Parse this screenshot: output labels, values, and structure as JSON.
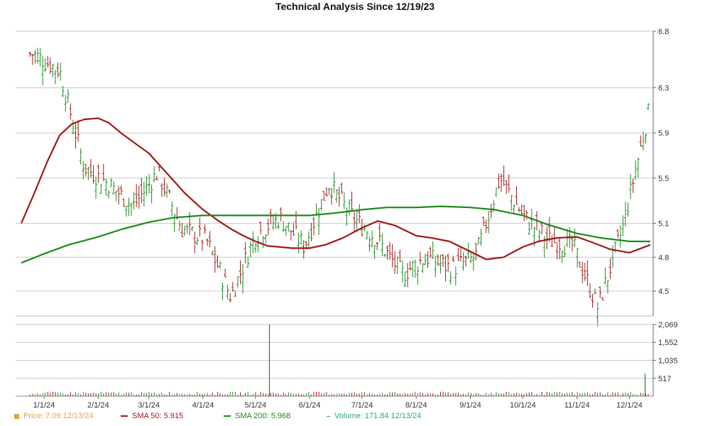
{
  "chart_data": [
    {
      "type": "candlestick-line",
      "title": "Technical Analysis Since 12/19/23",
      "ylim": [
        4.28,
        6.8
      ],
      "yticks": [
        "6.8",
        "6.3",
        "5.9",
        "5.5",
        "5.1",
        "4.8",
        "4.5"
      ],
      "ytick_values": [
        6.8,
        6.3,
        5.9,
        5.5,
        5.1,
        4.8,
        4.5
      ],
      "xticks": [
        "1/1/24",
        "2/1/24",
        "3/1/24",
        "4/1/24",
        "5/1/24",
        "6/1/24",
        "7/1/24",
        "8/1/24",
        "9/1/24",
        "10/1/24",
        "11/1/24",
        "12/1/24"
      ],
      "grid": true,
      "series": [
        {
          "name": "Price",
          "kind": "ohlc-bars",
          "color_up": "#1a8a1a",
          "color_down": "#a01818",
          "dates": [
            "12/26/23",
            "1/10/24",
            "1/24/24",
            "2/7/24",
            "2/21/24",
            "3/6/24",
            "3/20/24",
            "4/3/24",
            "4/17/24",
            "5/1/24",
            "5/15/24",
            "5/29/24",
            "6/12/24",
            "6/26/24",
            "7/10/24",
            "7/24/24",
            "8/7/24",
            "8/21/24",
            "9/4/24",
            "9/18/24",
            "10/2/24",
            "10/16/24",
            "10/30/24",
            "11/13/24",
            "11/27/24",
            "12/13/24"
          ],
          "close": [
            6.6,
            6.45,
            5.6,
            5.45,
            5.25,
            5.55,
            5.05,
            4.95,
            4.45,
            5.0,
            5.15,
            4.9,
            5.45,
            5.15,
            4.95,
            4.65,
            4.8,
            4.7,
            4.8,
            5.5,
            5.15,
            4.95,
            4.9,
            4.35,
            5.05,
            6.15
          ]
        },
        {
          "name": "SMA 50",
          "kind": "line",
          "color": "#a01818",
          "dates": [
            "12/19/23",
            "12/26/23",
            "1/3/24",
            "1/10/24",
            "1/17/24",
            "1/24/24",
            "2/1/24",
            "2/7/24",
            "2/14/24",
            "2/21/24",
            "3/1/24",
            "3/8/24",
            "3/15/24",
            "3/22/24",
            "4/1/24",
            "4/10/24",
            "4/17/24",
            "4/24/24",
            "5/1/24",
            "5/8/24",
            "5/15/24",
            "5/22/24",
            "6/1/24",
            "6/10/24",
            "6/20/24",
            "7/1/24",
            "7/10/24",
            "7/20/24",
            "8/1/24",
            "8/10/24",
            "8/20/24",
            "9/1/24",
            "9/10/24",
            "9/20/24",
            "10/1/24",
            "10/10/24",
            "10/20/24",
            "11/1/24",
            "11/10/24",
            "11/20/24",
            "12/1/24",
            "12/13/24"
          ],
          "values": [
            5.1,
            5.35,
            5.65,
            5.88,
            5.98,
            6.02,
            6.03,
            5.99,
            5.9,
            5.82,
            5.72,
            5.6,
            5.48,
            5.36,
            5.22,
            5.12,
            5.05,
            4.99,
            4.94,
            4.9,
            4.89,
            4.88,
            4.88,
            4.91,
            4.97,
            5.06,
            5.12,
            5.08,
            4.99,
            4.97,
            4.94,
            4.85,
            4.78,
            4.8,
            4.89,
            4.94,
            4.97,
            4.98,
            4.93,
            4.87,
            4.84,
            4.91
          ]
        },
        {
          "name": "SMA 200",
          "kind": "line",
          "color": "#1a8a1a",
          "dates": [
            "12/19/23",
            "1/1/24",
            "1/15/24",
            "2/1/24",
            "2/15/24",
            "3/1/24",
            "3/15/24",
            "4/1/24",
            "4/15/24",
            "5/1/24",
            "5/15/24",
            "6/1/24",
            "6/15/24",
            "7/1/24",
            "7/15/24",
            "8/1/24",
            "8/15/24",
            "9/1/24",
            "9/15/24",
            "10/1/24",
            "10/15/24",
            "11/1/24",
            "11/15/24",
            "12/1/24",
            "12/13/24"
          ],
          "values": [
            4.75,
            4.83,
            4.91,
            4.98,
            5.05,
            5.11,
            5.15,
            5.17,
            5.17,
            5.17,
            5.17,
            5.17,
            5.19,
            5.22,
            5.24,
            5.24,
            5.25,
            5.24,
            5.22,
            5.17,
            5.09,
            5.01,
            4.97,
            4.94,
            4.94
          ]
        }
      ]
    },
    {
      "type": "bar",
      "title": "",
      "ylim": [
        0,
        2069
      ],
      "yticks": [
        "2,069",
        "1,552",
        "1,035",
        "517"
      ],
      "ytick_values": [
        2069,
        1552,
        1035,
        517
      ],
      "series": [
        {
          "name": "Volume",
          "color": "#1a8a1a",
          "dates": [
            "12/26/23",
            "1/10/24",
            "1/24/24",
            "2/7/24",
            "2/21/24",
            "3/6/24",
            "3/20/24",
            "4/3/24",
            "4/17/24",
            "5/1/24",
            "5/9/24",
            "5/15/24",
            "5/29/24",
            "6/12/24",
            "6/26/24",
            "7/10/24",
            "7/24/24",
            "8/7/24",
            "8/21/24",
            "9/4/24",
            "9/18/24",
            "10/2/24",
            "10/16/24",
            "10/30/24",
            "11/13/24",
            "11/27/24",
            "12/10/24",
            "12/13/24"
          ],
          "values": [
            90,
            70,
            80,
            60,
            75,
            70,
            60,
            90,
            70,
            80,
            2069,
            60,
            70,
            70,
            80,
            85,
            60,
            90,
            60,
            80,
            60,
            90,
            70,
            140,
            100,
            110,
            650,
            171.84
          ]
        }
      ]
    }
  ],
  "legend": [
    {
      "label": "Price: 7.09  12/13/24",
      "color": "#e8a040",
      "swatch": "square"
    },
    {
      "label": "SMA 50: 5.915",
      "color": "#a01818",
      "swatch": "line"
    },
    {
      "label": "SMA 200: 5.968",
      "color": "#1a8a1a",
      "swatch": "line"
    },
    {
      "label": "Volume: 171.84  12/13/24",
      "color": "#2aaa7a",
      "swatch": "line"
    }
  ]
}
